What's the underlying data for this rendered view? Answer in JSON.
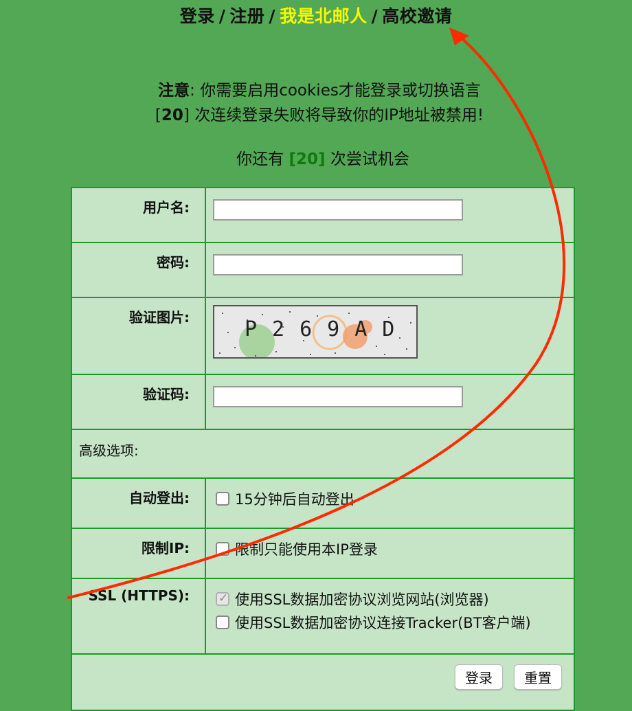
{
  "nav": {
    "login": "登录",
    "register": "注册",
    "bupt": "我是北邮人",
    "invite": "高校邀请",
    "separator": "/"
  },
  "notice": {
    "label": "注意",
    "line1_rest": ": 你需要启用cookies才能登录或切换语言",
    "line2_open": "[",
    "line2_count": "20",
    "line2_rest": "] 次连续登录失败将导致你的IP地址被禁用!"
  },
  "attempts": {
    "prefix": "你还有 ",
    "count": "[20]",
    "suffix": " 次尝试机会"
  },
  "form": {
    "username_label": "用户名:",
    "password_label": "密码:",
    "captcha_image_label": "验证图片:",
    "captcha_text": "P269AD",
    "captcha_code_label": "验证码:",
    "advanced_label": "高级选项:",
    "auto_logout_label": "自动登出:",
    "auto_logout_option": "15分钟后自动登出",
    "auto_logout_checked": false,
    "restrict_ip_label": "限制IP:",
    "restrict_ip_option": "限制只能使用本IP登录",
    "restrict_ip_checked": false,
    "ssl_label": "SSL (HTTPS):",
    "ssl_browse_option": "使用SSL数据加密协议浏览网站(浏览器)",
    "ssl_browse_checked": true,
    "ssl_tracker_option": "使用SSL数据加密协议连接Tracker(BT客户端)",
    "ssl_tracker_checked": false,
    "submit_label": "登录",
    "reset_label": "重置"
  },
  "colors": {
    "background": "#52a854",
    "form_bg": "#c6e5c7",
    "border": "#1c9a28",
    "active_nav": "#f7f700",
    "attempt_count": "#0f7a0f",
    "annotation_arrow": "#ff2a00"
  }
}
